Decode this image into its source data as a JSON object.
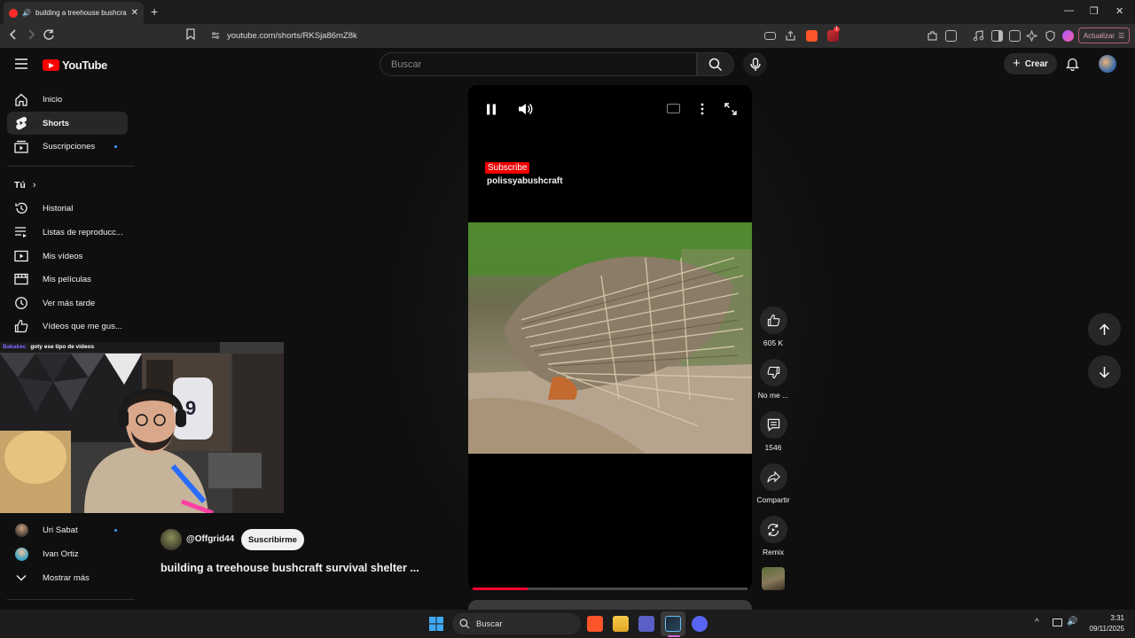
{
  "browser": {
    "tab_title": "building a treehouse bushcra",
    "url": "youtube.com/shorts/RKSja86mZ8k",
    "update_label": "Actualizar",
    "update_badge": "1"
  },
  "header": {
    "logo_text": "YouTube",
    "search_placeholder": "Buscar",
    "create_label": "Crear"
  },
  "sidebar": {
    "items": [
      {
        "label": "Inicio"
      },
      {
        "label": "Shorts"
      },
      {
        "label": "Suscripciones"
      }
    ],
    "you_label": "Tú",
    "you_items": [
      {
        "label": "Historial"
      },
      {
        "label": "Listas de reproducc..."
      },
      {
        "label": "Mis vídeos"
      },
      {
        "label": "Mis películas"
      },
      {
        "label": "Ver más tarde"
      },
      {
        "label": "Vídeos que me gus..."
      }
    ],
    "channels": [
      {
        "label": "Uri Sabat"
      },
      {
        "label": "Ivan Ortiz"
      }
    ],
    "show_more": "Mostrar más"
  },
  "webcam": {
    "chat_user": "Bakakec",
    "chat_msg": "goty ese tipo de videos"
  },
  "short": {
    "overlay_subscribe": "Subscribe",
    "overlay_channel": "polissyabushcraft",
    "channel_handle": "@Offgrid44",
    "subscribe_label": "Suscribirme",
    "title": "building a treehouse bushcraft survival shelter ...",
    "progress": 0.2
  },
  "actions": {
    "likes": "605 K",
    "dislike_label": "No me ...",
    "comments": "1546",
    "share_label": "Compartir",
    "remix_label": "Remix"
  },
  "taskbar": {
    "search_label": "Buscar",
    "time": "3:31",
    "date": "09/11/2025"
  },
  "colors": {
    "accent": "#ff0000",
    "progress": "#ff0033",
    "background": "#0f0f0f"
  }
}
